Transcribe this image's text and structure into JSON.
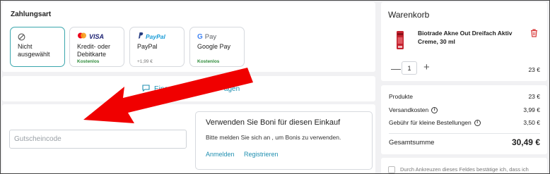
{
  "payment": {
    "title": "Zahlungsart",
    "options": [
      {
        "label": "Nicht ausgewählt",
        "sub": "",
        "icon": "ban-icon",
        "selected": true
      },
      {
        "label": "Kredit- oder Debitkarte",
        "sub": "Kostenlos",
        "logo": "VISA",
        "icon": "mastercard-icon"
      },
      {
        "label": "PayPal",
        "sub": "+1,99 €",
        "logo": "PayPal",
        "icon": "paypal-icon"
      },
      {
        "label": "Google Pay",
        "sub": "Kostenlos",
        "logo": "Pay",
        "icon": "google-icon"
      }
    ]
  },
  "comment": {
    "link_label": "Einen Kom",
    "link_label_tail": "agen",
    "icon": "comment-icon"
  },
  "voucher": {
    "placeholder": "Gutscheincode"
  },
  "boni": {
    "title": "Verwenden Sie Boni für diesen Einkauf",
    "text": "Bitte melden Sie sich an , um Bonis zu verwenden.",
    "login_label": "Anmelden",
    "register_label": "Registrieren"
  },
  "cart": {
    "title": "Warenkorb",
    "product_name": "Biotrade Akne Out Dreifach Aktiv Creme, 30 ml",
    "qty": "1",
    "price": "23 €",
    "minus": "—",
    "plus": "+"
  },
  "summary": {
    "rows": [
      {
        "label": "Produkte",
        "value": "23 €"
      },
      {
        "label": "Versandkosten",
        "value": "3,99 €",
        "info": true
      },
      {
        "label": "Gebühr für kleine Bestellungen",
        "value": "3,50 €",
        "info": true
      }
    ],
    "total_label": "Gesamtsumme",
    "total_value": "30,49 €"
  },
  "consent": {
    "text": "Durch Ankreuzen dieses Feldes bestätige ich, dass ich"
  },
  "colors": {
    "accent": "#1f8fb0",
    "selected_border": "#3aa6ad",
    "free_green": "#2e8b3a",
    "arrow_red": "#f00000",
    "trash_red": "#d83a3a"
  }
}
